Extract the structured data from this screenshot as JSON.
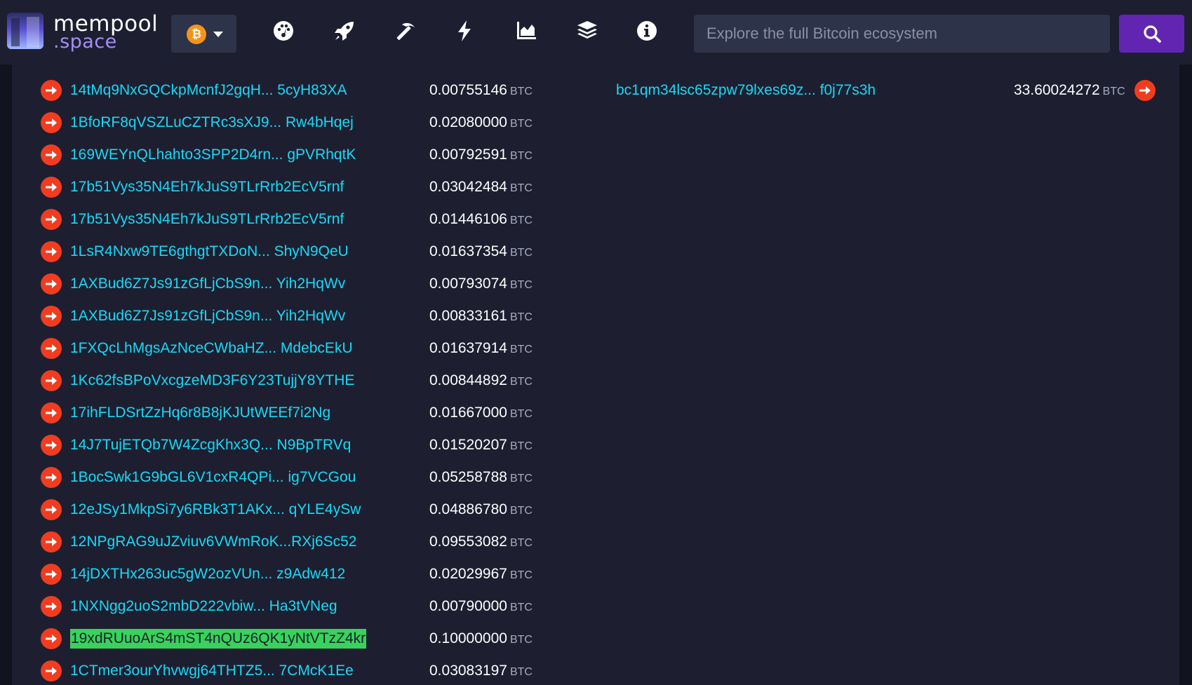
{
  "header": {
    "logo_top": "mempool",
    "logo_bottom": ".space",
    "network_symbol": "₿",
    "nav_icons": [
      "dashboard-icon",
      "rocket-icon",
      "mining-icon",
      "lightning-icon",
      "graphs-icon",
      "blocks-icon",
      "info-icon"
    ],
    "search_placeholder": "Explore the full Bitcoin ecosystem"
  },
  "colors": {
    "accent": "#6225b2",
    "link": "#1bd8f4",
    "arrow": "#f13c20",
    "highlight": "#37d35a",
    "bitcoin": "#f7931a"
  },
  "unit": "BTC",
  "inputs": [
    {
      "address": "14tMq9NxGQCkpMcnfJ2gqH... 5cyH83XA",
      "amount": "0.00755146"
    },
    {
      "address": "1BfoRF8qVSZLuCZTRc3sXJ9...  Rw4bHqej",
      "amount": "0.02080000"
    },
    {
      "address": "169WEYnQLhahto3SPP2D4rn... gPVRhqtK",
      "amount": "0.00792591"
    },
    {
      "address": "17b51Vys35N4Eh7kJuS9TLrRrb2EcV5rnf",
      "amount": "0.03042484"
    },
    {
      "address": "17b51Vys35N4Eh7kJuS9TLrRrb2EcV5rnf",
      "amount": "0.01446106"
    },
    {
      "address": "1LsR4Nxw9TE6gthgtTXDoN...  ShyN9QeU",
      "amount": "0.01637354"
    },
    {
      "address": "1AXBud6Z7Js91zGfLjCbS9n...   Yih2HqWv",
      "amount": "0.00793074"
    },
    {
      "address": "1AXBud6Z7Js91zGfLjCbS9n...   Yih2HqWv",
      "amount": "0.00833161"
    },
    {
      "address": "1FXQcLhMgsAzNceCWbaHZ... MdebcEkU",
      "amount": "0.01637914"
    },
    {
      "address": "1Kc62fsBPoVxcgzeMD3F6Y23TujjY8YTHE",
      "amount": "0.00844892"
    },
    {
      "address": "17ihFLDSrtZzHq6r8B8jKJUtWEEf7i2Ng",
      "amount": "0.01667000"
    },
    {
      "address": "14J7TujETQb7W4ZcgKhx3Q...  N9BpTRVq",
      "amount": "0.01520207"
    },
    {
      "address": "1BocSwk1G9bGL6V1cxR4QPi... ig7VCGou",
      "amount": "0.05258788"
    },
    {
      "address": "12eJSy1MkpSi7y6RBk3T1AKx... qYLE4ySw",
      "amount": "0.04886780"
    },
    {
      "address": "12NPgRAG9uJZviuv6VWmRoK...RXj6Sc52",
      "amount": "0.09553082"
    },
    {
      "address": "14jDXTHx263uc5gW2ozVUn...  z9Adw412",
      "amount": "0.02029967"
    },
    {
      "address": "1NXNgg2uoS2mbD222vbiw...  Ha3tVNeg",
      "amount": "0.00790000"
    },
    {
      "address": "19xdRUuoArS4mST4nQUz6QK1yNtVTzZ4kr",
      "amount": "0.10000000",
      "highlighted": true
    },
    {
      "address": "1CTmer3ourYhvwgj64THTZ5...  7CMcK1Ee",
      "amount": "0.03083197"
    }
  ],
  "outputs": [
    {
      "address": "bc1qm34lsc65zpw79lxes69z...  f0j77s3h",
      "amount": "33.60024272"
    }
  ]
}
